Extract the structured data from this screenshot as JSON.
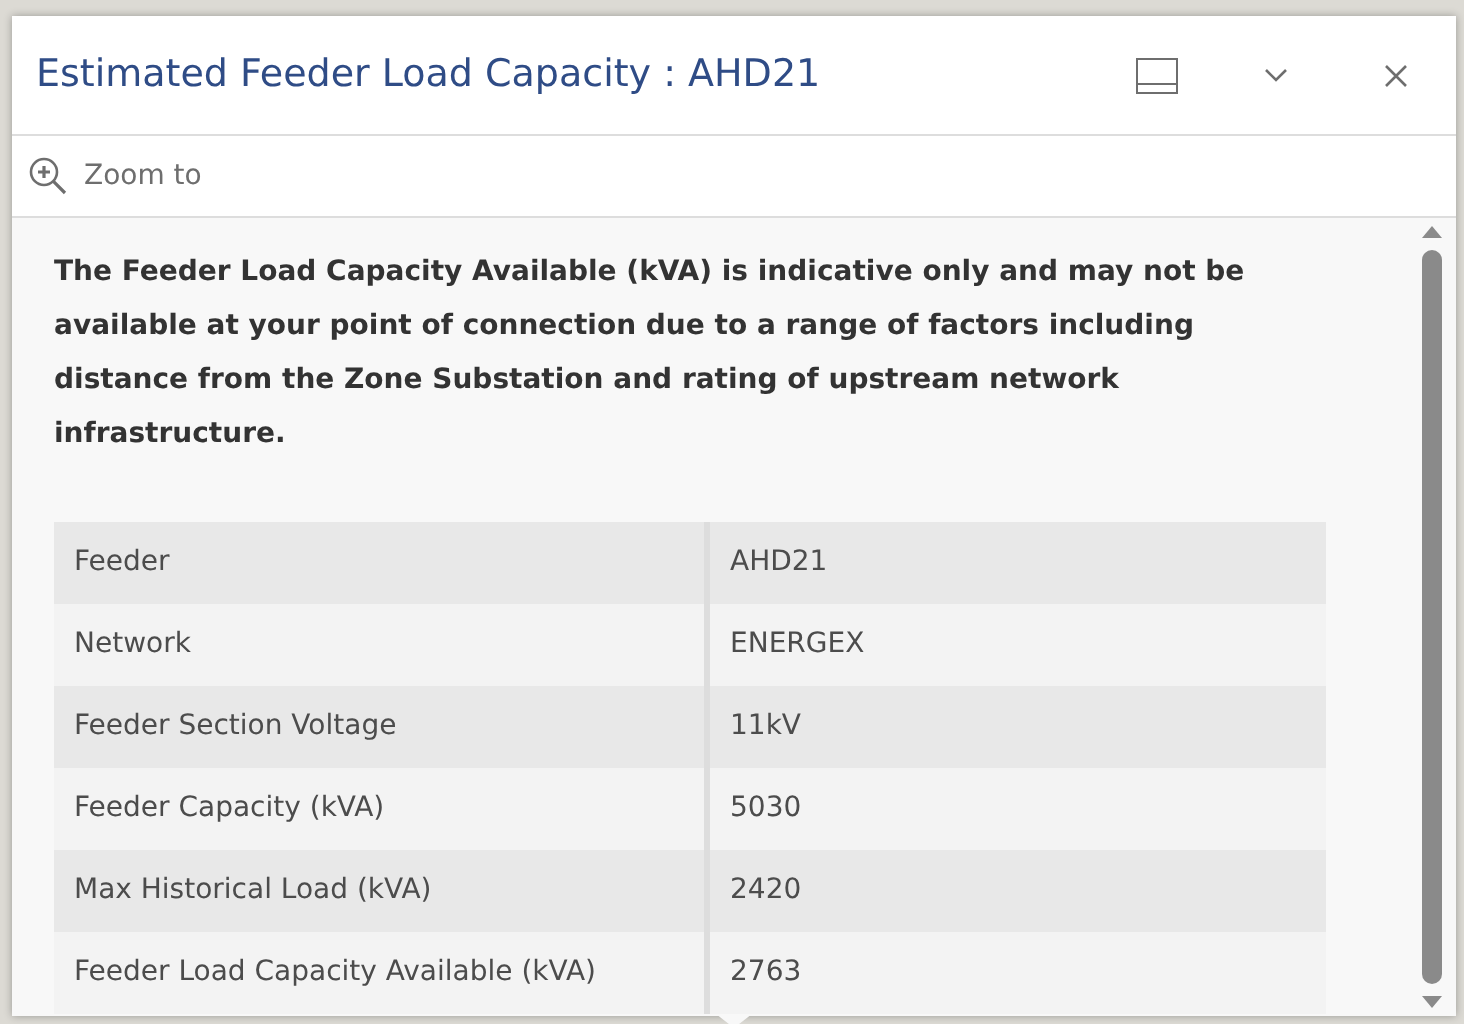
{
  "popup": {
    "title": "Estimated Feeder Load Capacity : AHD21"
  },
  "actions": [
    {
      "label": "Zoom to"
    }
  ],
  "notice": "The Feeder Load Capacity Available (kVA) is indicative only and may not be available at your point of connection due to a range of factors including distance from the Zone Substation and rating of upstream network infrastructure.",
  "table": {
    "rows": [
      {
        "field": "Feeder",
        "value": "AHD21"
      },
      {
        "field": "Network",
        "value": "ENERGEX"
      },
      {
        "field": "Feeder Section Voltage",
        "value": "11kV"
      },
      {
        "field": "Feeder Capacity (kVA)",
        "value": "5030"
      },
      {
        "field": "Max Historical Load (kVA)",
        "value": "2420"
      },
      {
        "field": "Feeder Load Capacity Available (kVA)",
        "value": "2763"
      }
    ]
  }
}
